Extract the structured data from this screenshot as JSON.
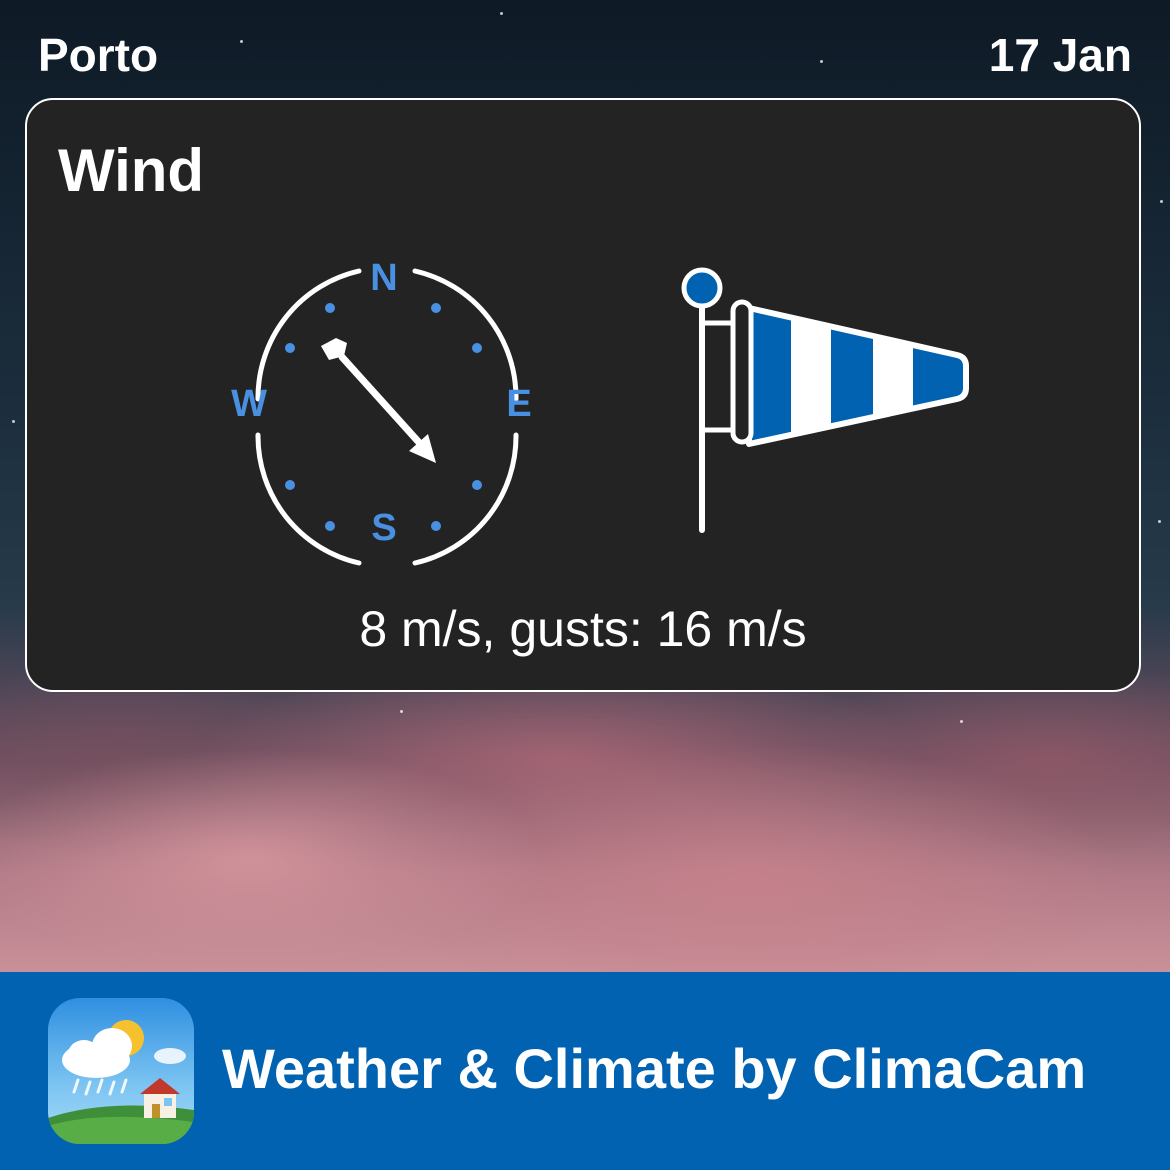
{
  "header": {
    "city": "Porto",
    "date": "17 Jan"
  },
  "card": {
    "title": "Wind",
    "compass": {
      "labels": {
        "north": "N",
        "south": "S",
        "east": "E",
        "west": "W"
      },
      "accent_color": "#4a90e2",
      "arrow_icon": "wind-direction-arrow"
    },
    "windsock_icon": "windsock-icon",
    "wind_text": "8 m/s, gusts: 16 m/s"
  },
  "footer": {
    "app_name": "Weather & Climate by ClimaCam",
    "background_color": "#0062b0",
    "app_icon": "climacam-app-icon"
  }
}
